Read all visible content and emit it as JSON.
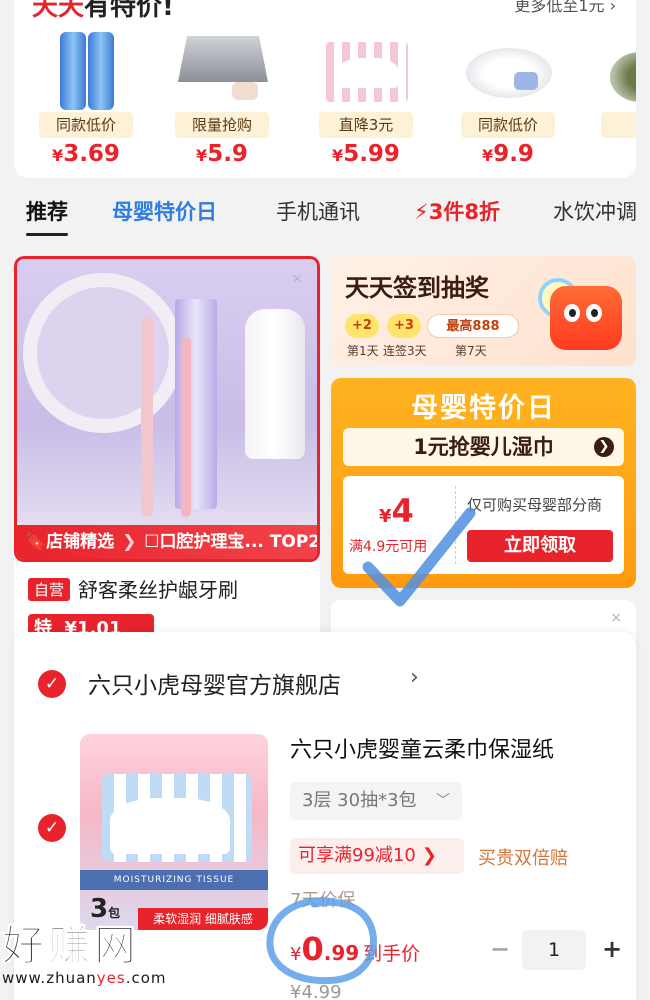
{
  "deals_section": {
    "title_part1": "天天",
    "title_part2": "有特价!",
    "more_link": "更多低至1元 ›",
    "items": [
      {
        "tag": "同款低价",
        "currency": "¥",
        "price": "3.69"
      },
      {
        "tag": "限量抢购",
        "currency": "¥",
        "price": "5.9"
      },
      {
        "tag": "直降3元",
        "currency": "¥",
        "price": "5.99"
      },
      {
        "tag": "同款低价",
        "currency": "¥",
        "price": "9.9"
      },
      {
        "tag": "同",
        "currency": "¥",
        "price": ""
      }
    ]
  },
  "tabs": [
    {
      "label": "推荐"
    },
    {
      "label": "母婴特价日"
    },
    {
      "label": "手机通讯"
    },
    {
      "label": "3件8折"
    },
    {
      "label": "水饮冲调"
    }
  ],
  "product_card": {
    "close": "×",
    "promo_bar_left": "店铺精选",
    "promo_bar_right": "口腔护理宝... TOP2",
    "self_tag": "自营",
    "name": "舒客柔丝护龈牙刷",
    "special_label": "特",
    "special_price": "¥1.01"
  },
  "signin_card": {
    "title": "天天签到抽奖",
    "chips": [
      "+2",
      "+3",
      "最高888"
    ],
    "chip_labels": [
      "第1天",
      "连签3天",
      "第7天"
    ]
  },
  "mom_card": {
    "title": "母婴特价日",
    "bar_text": "1元抢婴儿湿巾",
    "coupon_currency": "¥",
    "coupon_amount": "4",
    "coupon_condition": "满4.9元可用",
    "coupon_note": "仅可购买母婴部分商",
    "claim_label": "立即领取"
  },
  "blank_card": {
    "close": "×"
  },
  "cart": {
    "store_name": "六只小虎母婴官方旗舰店",
    "store_chevron": "›",
    "item": {
      "title": "六只小虎婴童云柔巾保湿纸",
      "sku": "3层 30抽*3包",
      "promo": "可享满99减10",
      "guarantee": "买贵双倍赔",
      "faded_text": "7天价保",
      "price_currency": "¥",
      "price_int": "0",
      "price_dec": ".99",
      "price_label": "到手价",
      "original_price": "¥4.99",
      "quantity": "1",
      "minus": "−",
      "plus": "+",
      "thumb_band": "MOISTURIZING TISSUE",
      "thumb_count": "3",
      "thumb_count_unit": "包",
      "thumb_strip": "柔软湿润 细腻肤感"
    }
  },
  "watermark": {
    "text": "好赚网",
    "url_prefix": "www.zhuan",
    "url_highlight": "yes",
    "url_suffix": ".com"
  },
  "colors": {
    "accent_red": "#e8232c",
    "blue": "#2f7de1",
    "orange": "#ff9a10"
  }
}
